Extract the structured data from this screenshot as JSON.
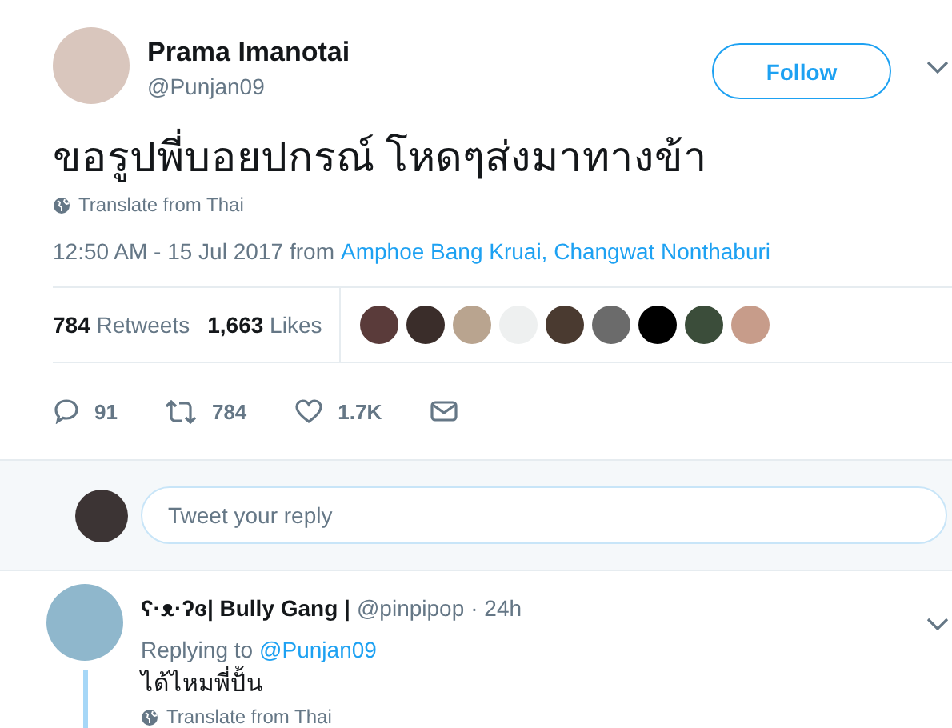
{
  "tweet": {
    "name": "Prama Imanotai",
    "handle": "@Punjan09",
    "follow_button": "Follow",
    "text": "ขอรูปพี่บอยปกรณ์ โหดๆส่งมาทางข้า",
    "translate": "Translate from Thai",
    "time": "12:50 AM - 15 Jul 2017",
    "from": "from",
    "place": "Amphoe Bang Kruai, Changwat Nonthaburi",
    "stats": [
      {
        "count": "784",
        "label": "Retweets"
      },
      {
        "count": "1,663",
        "label": "Likes"
      }
    ],
    "actions": [
      {
        "kind": "reply",
        "count": "91"
      },
      {
        "kind": "retweet",
        "count": "784"
      },
      {
        "kind": "like",
        "count": "1.7K"
      },
      {
        "kind": "message"
      }
    ]
  },
  "reply_box": {
    "placeholder": "Tweet your reply"
  },
  "replies": [
    {
      "name": "ʕ·ᴥ·ʔɞ| Bully Gang |",
      "handle": "@pinpipop",
      "time": "· 24h",
      "replying_label": "Replying to",
      "replying_to": "@Punjan09",
      "text": "ได้ไหมพี่ปั้น",
      "translate": "Translate from Thai"
    }
  ]
}
